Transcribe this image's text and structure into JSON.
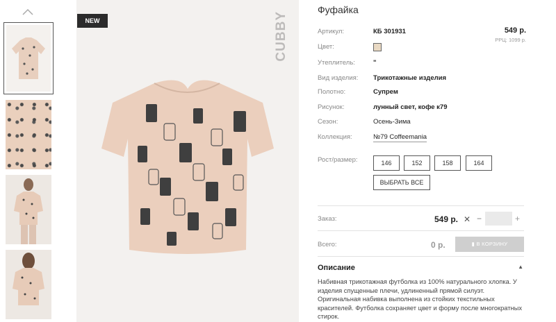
{
  "gallery": {
    "badge": "NEW",
    "brand": "CUBBY"
  },
  "product": {
    "title": "Фуфайка",
    "price": "549 р.",
    "rrp": "РРЦ: 1099 р.",
    "specs": [
      {
        "label": "Артикул:",
        "value": "КБ 301931"
      },
      {
        "label": "Цвет:",
        "value": ""
      },
      {
        "label": "Утеплитель:",
        "value": "\""
      },
      {
        "label": "Вид изделия:",
        "value": "Трикотажные изделия"
      },
      {
        "label": "Полотно:",
        "value": "Супрем"
      },
      {
        "label": "Рисунок:",
        "value": "лунный свет, кофе к79"
      },
      {
        "label": "Сезон:",
        "value": "Осень-Зима"
      },
      {
        "label": "Коллекция:",
        "value": "№79 Coffeemania"
      }
    ],
    "swatch_color": "#e9d9c3"
  },
  "sizes": {
    "label": "Рост/размер:",
    "options": [
      "146",
      "152",
      "158",
      "164"
    ],
    "select_all": "ВЫБРАТЬ ВСЕ"
  },
  "order": {
    "label": "Заказ:",
    "price": "549 р.",
    "qty_value": "",
    "total_label": "Всего:",
    "total": "0 р.",
    "cart_button": "В КОРЗИНУ"
  },
  "description": {
    "heading": "Описание",
    "text": "Набивная трикотажная футболка из 100% натурального хлопка. У изделия спущенные плечи, удлиненный прямой силуэт. Оригинальная набивка выполнена из стойких текстильных красителей. Футболка сохраняет цвет и форму после многократных стирок."
  }
}
